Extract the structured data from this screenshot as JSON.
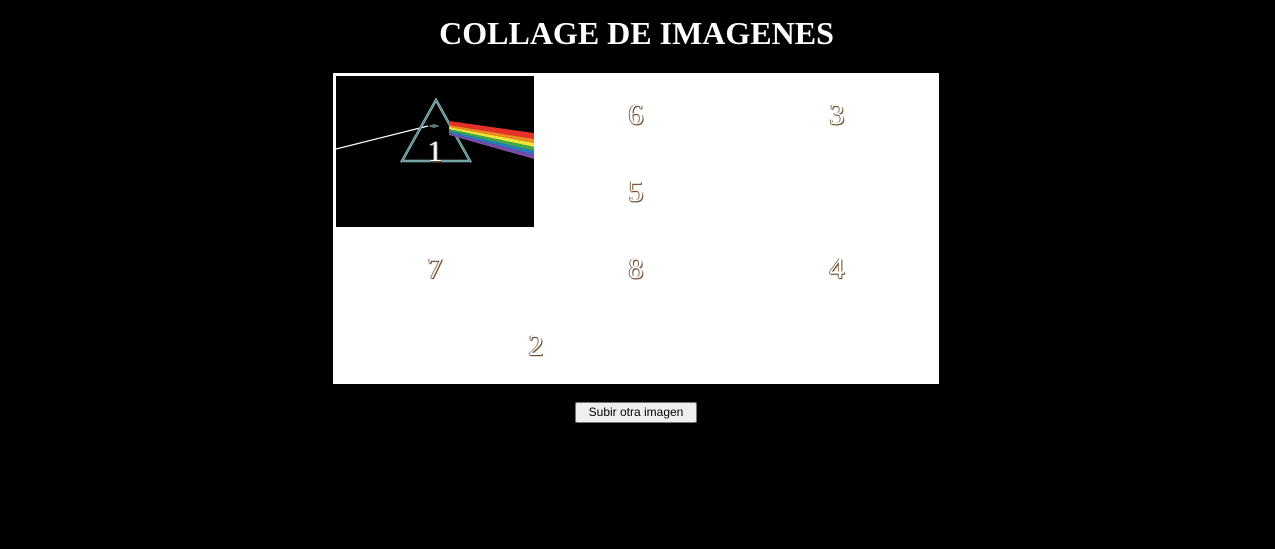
{
  "page": {
    "title": "COLLAGE DE IMAGENES",
    "background_color": "#000000"
  },
  "collage": {
    "background_color": "#ffffff",
    "tiles": [
      {
        "label": "1",
        "image": "dark-side-prism-icon"
      },
      {
        "label": "6"
      },
      {
        "label": "3"
      },
      {
        "label": "5"
      },
      {
        "label": "7"
      },
      {
        "label": "8"
      },
      {
        "label": "4"
      },
      {
        "label": "2"
      }
    ]
  },
  "actions": {
    "upload_label": "Subir otra imagen"
  }
}
